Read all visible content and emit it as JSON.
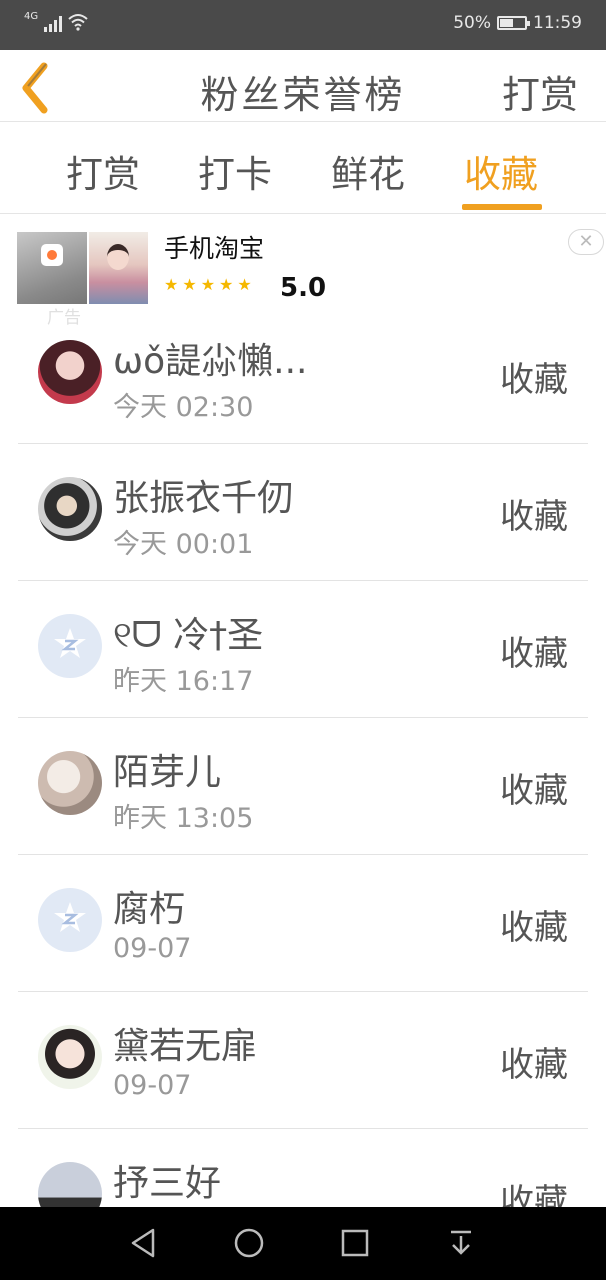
{
  "status_bar": {
    "network": "4G",
    "battery_percent": "50%",
    "battery_level": 0.5,
    "time": "11:59"
  },
  "header": {
    "title": "粉丝荣誉榜",
    "action_label": "打赏",
    "back_icon": "chevron-left-icon",
    "accent_color": "#f0a020"
  },
  "tabs": [
    {
      "label": "打赏",
      "active": false
    },
    {
      "label": "打卡",
      "active": false
    },
    {
      "label": "鲜花",
      "active": false
    },
    {
      "label": "收藏",
      "active": true
    }
  ],
  "ad": {
    "label": "广告",
    "app_name": "手机淘宝",
    "rating": "5.0",
    "stars": 5,
    "close_icon": "close-icon"
  },
  "list": [
    {
      "name": "ωǒ諟尛懶...",
      "time": "今天 02:30",
      "action": "收藏"
    },
    {
      "name": "张振衣千仞",
      "time": "今天 00:01",
      "action": "收藏"
    },
    {
      "name": "୧ᗜ 冷†圣",
      "time": "昨天 16:17",
      "action": "收藏"
    },
    {
      "name": "陌芽儿",
      "time": "昨天 13:05",
      "action": "收藏"
    },
    {
      "name": "腐朽",
      "time": "09-07",
      "action": "收藏"
    },
    {
      "name": "黛若无扉",
      "time": "09-07",
      "action": "收藏"
    },
    {
      "name": "抒三好",
      "time": "",
      "action": "收藏"
    }
  ],
  "nav_bar": {
    "back_icon": "triangle-back-icon",
    "home_icon": "circle-home-icon",
    "recents_icon": "square-recents-icon",
    "notification_icon": "pull-down-icon"
  }
}
